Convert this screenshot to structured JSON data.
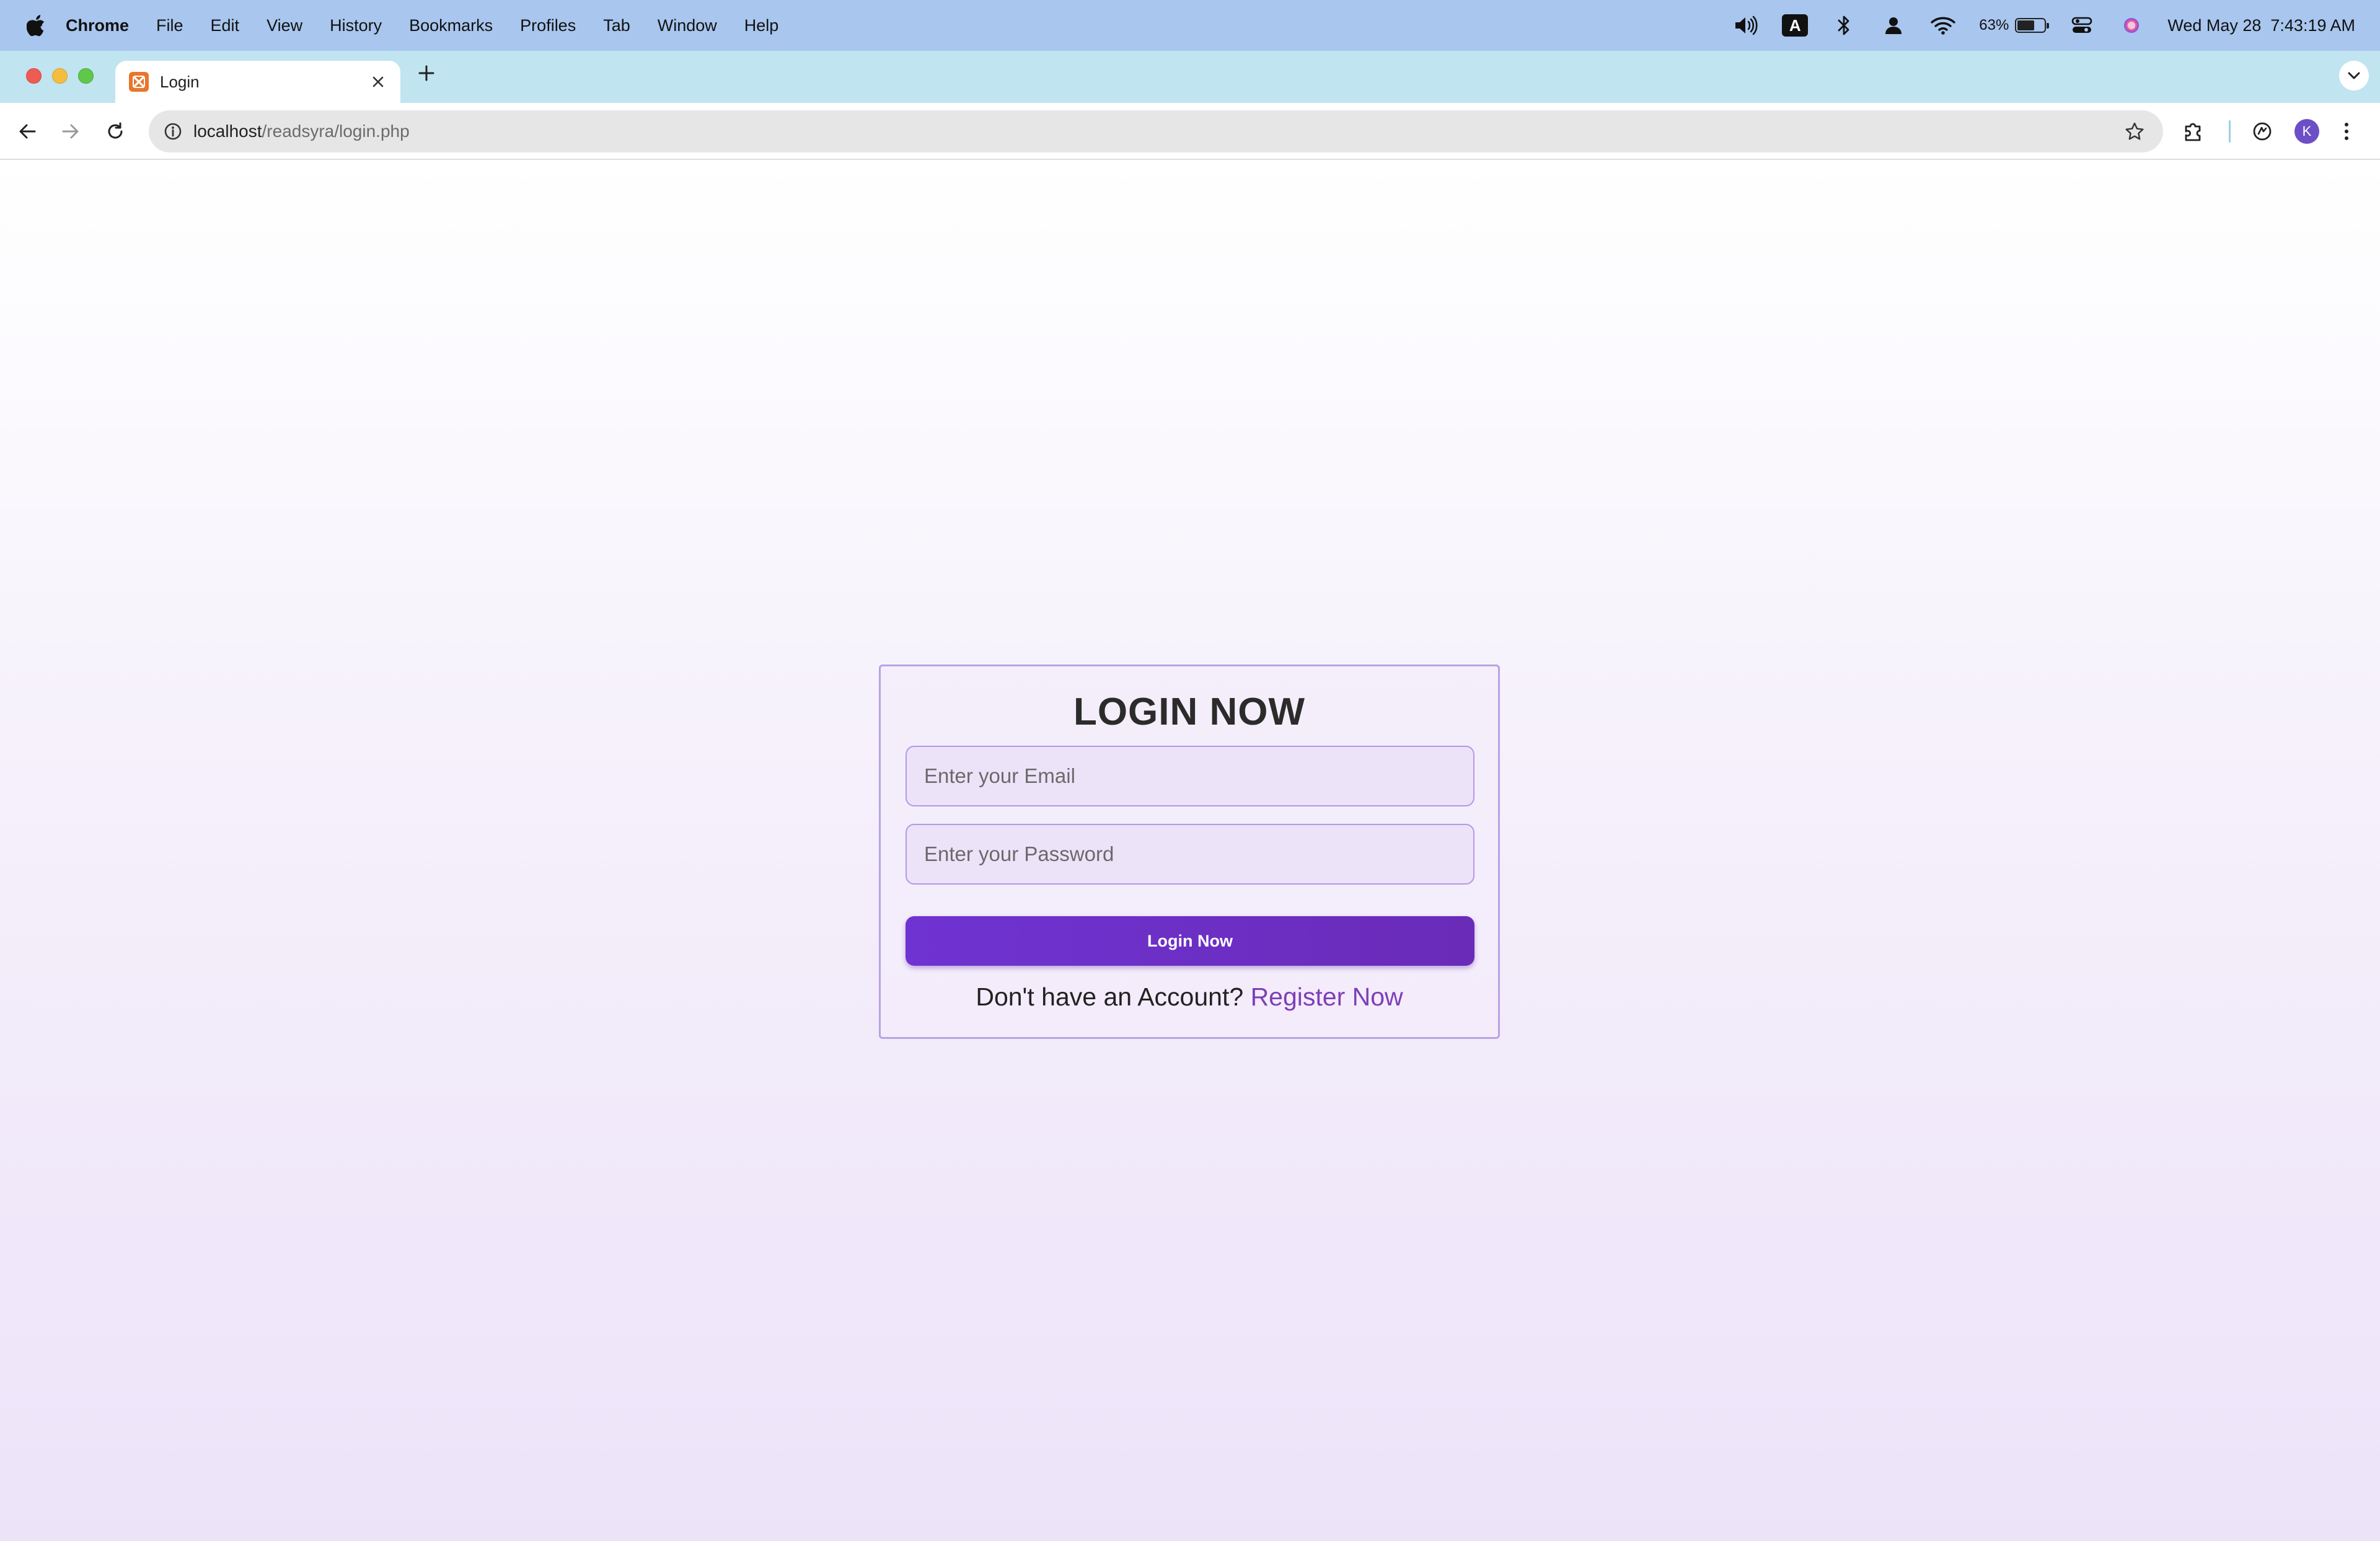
{
  "menubar": {
    "app_name": "Chrome",
    "items": [
      "File",
      "Edit",
      "View",
      "History",
      "Bookmarks",
      "Profiles",
      "Tab",
      "Window",
      "Help"
    ],
    "status": {
      "input_source": "A",
      "battery_percent": "63%",
      "battery_level": 0.63,
      "datetime": "Wed May 28  7:43:19 AM"
    }
  },
  "browser": {
    "tab_title": "Login",
    "url_host": "localhost",
    "url_path": "/readsyra/login.php",
    "profile_initial": "K"
  },
  "login": {
    "title": "LOGIN NOW",
    "email_placeholder": "Enter your Email",
    "password_placeholder": "Enter your Password",
    "submit_label": "Login Now",
    "register_prompt": "Don't have an Account?",
    "register_link": "Register Now"
  },
  "colors": {
    "accent": "#6f33d2",
    "link": "#7d3fb8",
    "field_border": "#b497e6",
    "menubar": "#a8c6ee",
    "tabstrip": "#c0e4f0"
  }
}
